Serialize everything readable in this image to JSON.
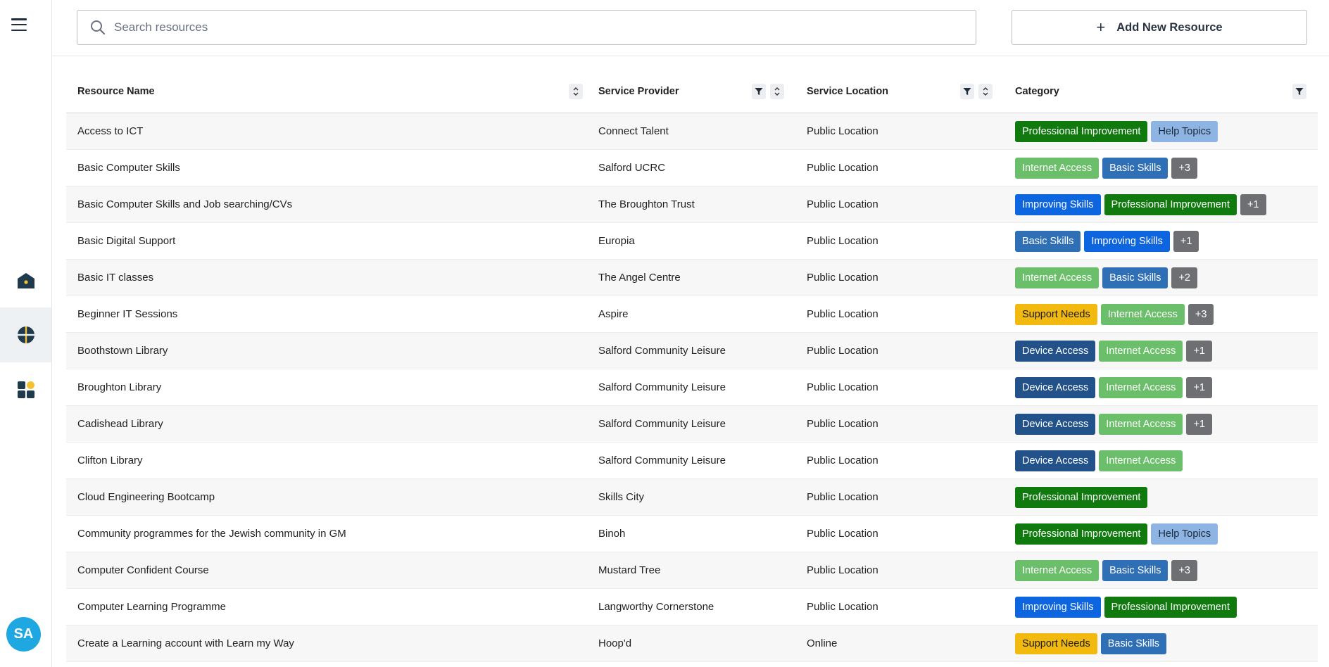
{
  "search": {
    "placeholder": "Search resources"
  },
  "toolbar": {
    "add_label": "Add New Resource"
  },
  "user": {
    "initials": "SA"
  },
  "columns": {
    "name": "Resource Name",
    "provider": "Service Provider",
    "location": "Service Location",
    "category": "Category"
  },
  "tag_colors": {
    "Professional Improvement": {
      "bg": "#117a0f",
      "fg": "#ffffff"
    },
    "Help Topics": {
      "bg": "#8eb4e3",
      "fg": "#1a2a3a"
    },
    "Internet Access": {
      "bg": "#6cbf6a",
      "fg": "#ffffff"
    },
    "Basic Skills": {
      "bg": "#2f6fb5",
      "fg": "#ffffff"
    },
    "Improving Skills": {
      "bg": "#0d66e0",
      "fg": "#ffffff"
    },
    "Support Needs": {
      "bg": "#f2b90f",
      "fg": "#1a1a1a"
    },
    "Device Access": {
      "bg": "#23528a",
      "fg": "#ffffff"
    },
    "more": {
      "bg": "#6d6f72",
      "fg": "#ffffff"
    }
  },
  "rows": [
    {
      "name": "Access to ICT",
      "provider": "Connect Talent",
      "location": "Public Location",
      "tags": [
        "Professional Improvement",
        "Help Topics"
      ],
      "more": ""
    },
    {
      "name": "Basic Computer Skills",
      "provider": "Salford UCRC",
      "location": "Public Location",
      "tags": [
        "Internet Access",
        "Basic Skills"
      ],
      "more": "+3"
    },
    {
      "name": "Basic Computer Skills and Job searching/CVs",
      "provider": "The Broughton Trust",
      "location": "Public Location",
      "tags": [
        "Improving Skills",
        "Professional Improvement"
      ],
      "more": "+1"
    },
    {
      "name": "Basic Digital Support",
      "provider": "Europia",
      "location": "Public Location",
      "tags": [
        "Basic Skills",
        "Improving Skills"
      ],
      "more": "+1"
    },
    {
      "name": "Basic IT classes",
      "provider": "The Angel Centre",
      "location": "Public Location",
      "tags": [
        "Internet Access",
        "Basic Skills"
      ],
      "more": "+2"
    },
    {
      "name": "Beginner IT Sessions",
      "provider": "Aspire",
      "location": "Public Location",
      "tags": [
        "Support Needs",
        "Internet Access"
      ],
      "more": "+3"
    },
    {
      "name": "Boothstown Library",
      "provider": "Salford Community Leisure",
      "location": "Public Location",
      "tags": [
        "Device Access",
        "Internet Access"
      ],
      "more": "+1"
    },
    {
      "name": "Broughton Library",
      "provider": "Salford Community Leisure",
      "location": "Public Location",
      "tags": [
        "Device Access",
        "Internet Access"
      ],
      "more": "+1"
    },
    {
      "name": "Cadishead Library",
      "provider": "Salford Community Leisure",
      "location": "Public Location",
      "tags": [
        "Device Access",
        "Internet Access"
      ],
      "more": "+1"
    },
    {
      "name": "Clifton Library",
      "provider": "Salford Community Leisure",
      "location": "Public Location",
      "tags": [
        "Device Access",
        "Internet Access"
      ],
      "more": ""
    },
    {
      "name": "Cloud Engineering Bootcamp",
      "provider": "Skills City",
      "location": "Public Location",
      "tags": [
        "Professional Improvement"
      ],
      "more": ""
    },
    {
      "name": "Community programmes for the Jewish community in GM",
      "provider": "Binoh",
      "location": "Public Location",
      "tags": [
        "Professional Improvement",
        "Help Topics"
      ],
      "more": ""
    },
    {
      "name": "Computer Confident Course",
      "provider": "Mustard Tree",
      "location": "Public Location",
      "tags": [
        "Internet Access",
        "Basic Skills"
      ],
      "more": "+3"
    },
    {
      "name": "Computer Learning Programme",
      "provider": "Langworthy Cornerstone",
      "location": "Public Location",
      "tags": [
        "Improving Skills",
        "Professional Improvement"
      ],
      "more": ""
    },
    {
      "name": "Create a Learning account with Learn my Way",
      "provider": "Hoop'd",
      "location": "Online",
      "tags": [
        "Support Needs",
        "Basic Skills"
      ],
      "more": ""
    }
  ]
}
